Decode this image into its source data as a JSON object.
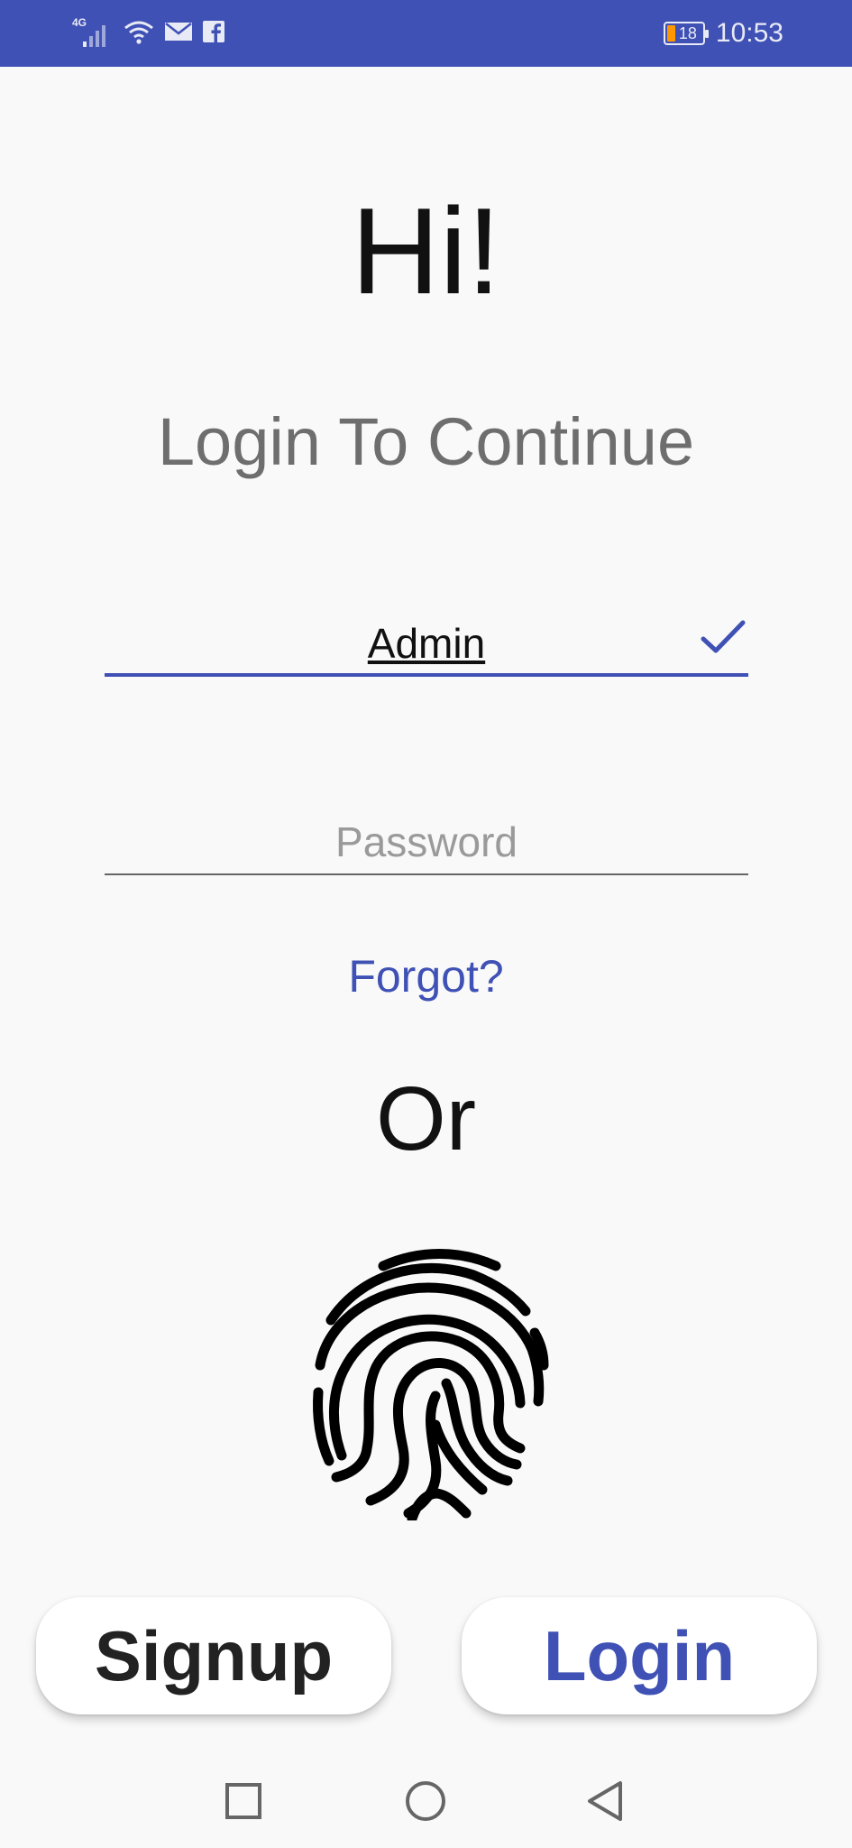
{
  "status_bar": {
    "network": "4G",
    "battery": "18",
    "time": "10:53",
    "icons": [
      "signal-icon",
      "wifi-icon",
      "mail-icon",
      "facebook-icon",
      "battery-icon"
    ],
    "accent": "#3f51b5",
    "battery_color": "#ff9800"
  },
  "main": {
    "greeting": "Hi!",
    "subtitle": "Login To Continue",
    "username_value": "Admin",
    "password_placeholder": "Password",
    "forgot_link": "Forgot?",
    "divider_text": "Or",
    "fingerprint_icon": "fingerprint-icon"
  },
  "buttons": {
    "signup": "Signup",
    "login": "Login"
  },
  "nav": {
    "recents_icon": "square-icon",
    "home_icon": "circle-icon",
    "back_icon": "triangle-back-icon"
  },
  "colors": {
    "primary": "#3f51b5",
    "background": "#f9f9f9",
    "subtitle_text": "#6e6e6e"
  }
}
